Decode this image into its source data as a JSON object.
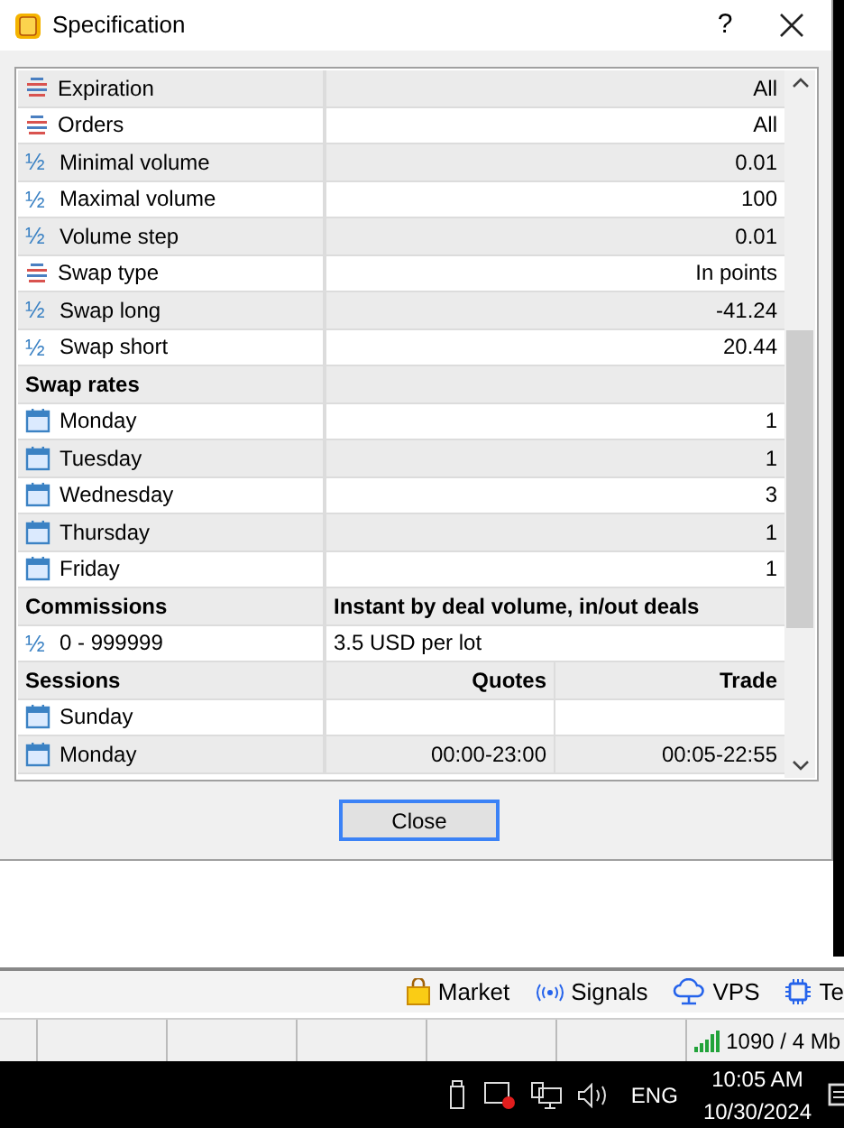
{
  "dialog": {
    "title": "Specification",
    "help": "?",
    "rows": [
      {
        "kind": "option",
        "cells": [
          "Expiration",
          "All"
        ]
      },
      {
        "kind": "option",
        "cells": [
          "Orders",
          "All"
        ]
      },
      {
        "kind": "volume",
        "marker": "½",
        "cells": [
          "Minimal volume",
          "0.01"
        ]
      },
      {
        "kind": "volume",
        "marker": "½",
        "cells": [
          "Maximal volume",
          "100"
        ]
      },
      {
        "kind": "volume",
        "marker": "½",
        "cells": [
          "Volume step",
          "0.01"
        ]
      },
      {
        "kind": "option",
        "cells": [
          "Swap type",
          "In points"
        ]
      },
      {
        "kind": "volume",
        "marker": "½",
        "cells": [
          "Swap long",
          "-41.24"
        ]
      },
      {
        "kind": "volume",
        "marker": "½",
        "cells": [
          "Swap short",
          "20.44"
        ]
      },
      {
        "kind": "section",
        "cells": [
          "Swap rates"
        ]
      },
      {
        "kind": "day",
        "cells": [
          "Monday",
          "1"
        ]
      },
      {
        "kind": "day",
        "cells": [
          "Tuesday",
          "1"
        ]
      },
      {
        "kind": "day",
        "cells": [
          "Wednesday",
          "3"
        ]
      },
      {
        "kind": "day",
        "cells": [
          "Thursday",
          "1"
        ]
      },
      {
        "kind": "day",
        "cells": [
          "Friday",
          "1"
        ]
      },
      {
        "kind": "section_text",
        "cells": [
          "Commissions",
          "Instant by deal volume, in/out deals"
        ]
      },
      {
        "kind": "volume_text",
        "marker": "½",
        "cells": [
          "0 - 999999",
          "3.5 USD per lot"
        ]
      },
      {
        "kind": "section",
        "cells": [
          "Sessions",
          "Quotes",
          "Trade"
        ]
      },
      {
        "kind": "day",
        "cells": [
          "Sunday"
        ]
      },
      {
        "kind": "day",
        "cells": [
          "Monday",
          "00:00-23:00",
          "00:05-22:55"
        ]
      }
    ],
    "button": "Close"
  },
  "toolbar": [
    {
      "kind": "market",
      "label": "Market"
    },
    {
      "kind": "signals",
      "label": "Signals"
    },
    {
      "kind": "vps",
      "label": "VPS"
    },
    {
      "kind": "tester",
      "label": "Te"
    }
  ],
  "status_bar": {
    "connection": "1090 / 4 Mb"
  },
  "taskbar": {
    "language": "ENG",
    "time": "10:05 AM",
    "date": "10/30/2024"
  }
}
